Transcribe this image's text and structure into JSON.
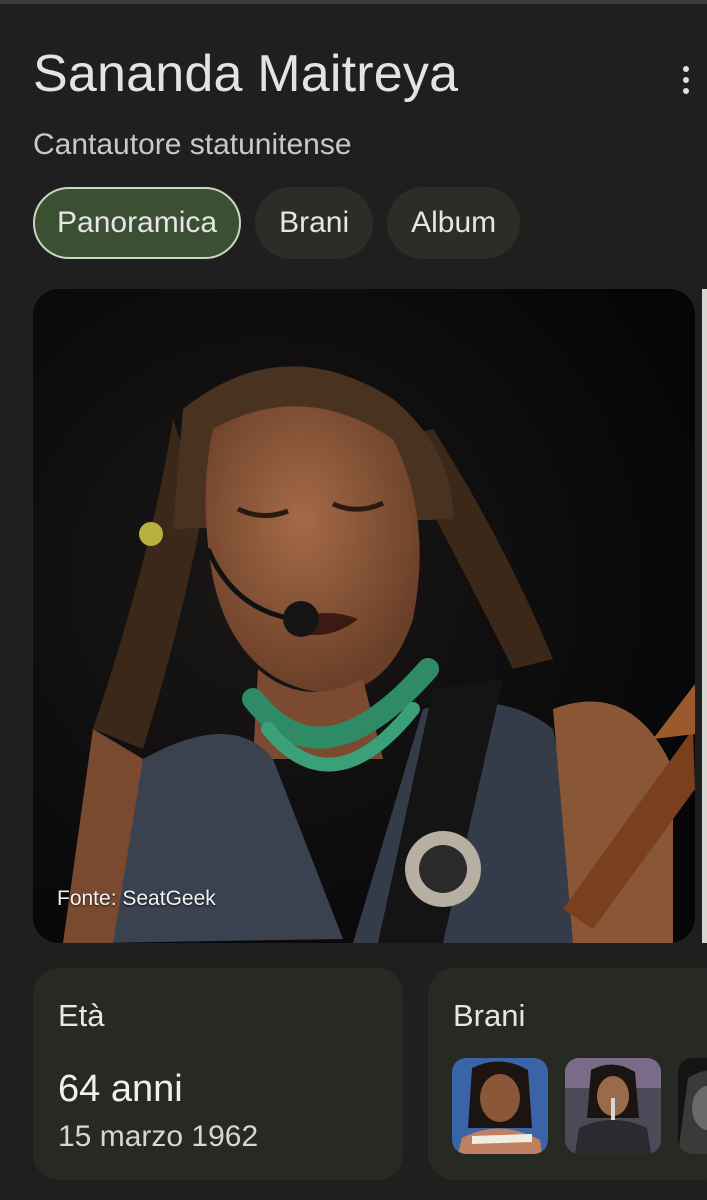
{
  "header": {
    "title": "Sananda Maitreya",
    "subtitle": "Cantautore statunitense",
    "menu_icon": "more-vert-icon"
  },
  "tabs": [
    {
      "label": "Panoramica",
      "active": true
    },
    {
      "label": "Brani",
      "active": false
    },
    {
      "label": "Album",
      "active": false
    }
  ],
  "photo": {
    "source": "Fonte: SeatGeek"
  },
  "age_card": {
    "label": "Età",
    "value": "64 anni",
    "date": "15 marzo 1962"
  },
  "songs_card": {
    "label": "Brani"
  },
  "colors": {
    "background": "#1f1f1f",
    "tab_active_bg": "#3b4f33",
    "tab_active_border": "#c9d8bd",
    "tab_bg": "#2a2e26",
    "card_bg": "#262a23"
  }
}
